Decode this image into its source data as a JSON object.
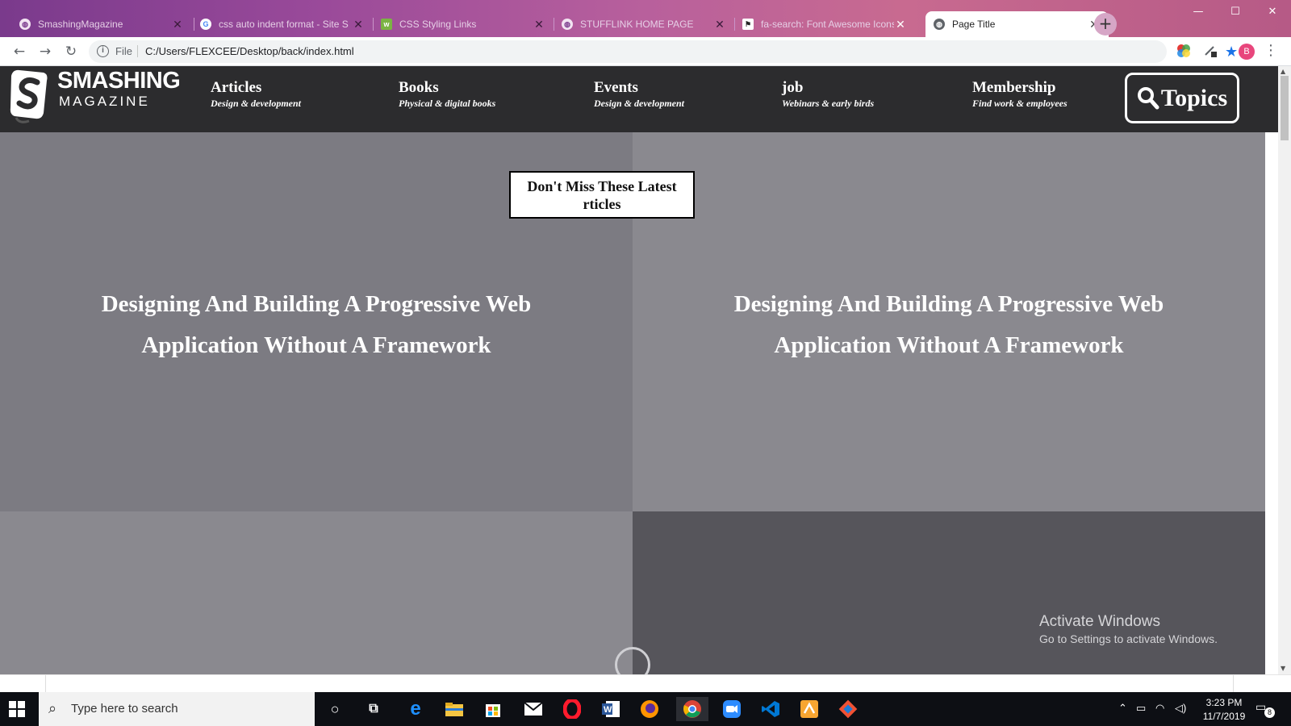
{
  "browser": {
    "tabs": [
      {
        "label": "SmashingMagazine",
        "icon": "globe-icon",
        "active": false
      },
      {
        "label": "css auto indent format - Site S",
        "icon": "google-icon",
        "active": false
      },
      {
        "label": "CSS Styling Links",
        "icon": "w3-icon",
        "active": false
      },
      {
        "label": "STUFFLINK HOME PAGE",
        "icon": "globe-icon",
        "active": false
      },
      {
        "label": "fa-search: Font Awesome Icons",
        "icon": "flag-icon",
        "active": false
      },
      {
        "label": "Page Title",
        "icon": "globe-icon",
        "active": true
      }
    ],
    "address": {
      "scheme_label": "File",
      "url": "C:/Users/FLEXCEE/Desktop/back/index.html"
    },
    "profile_initial": "B",
    "accent_color": "#1a73e8"
  },
  "site": {
    "logo": {
      "line1": "SMASHING",
      "line2": "MAGAZINE"
    },
    "nav": [
      {
        "title": "Articles",
        "subtitle": "Design & development"
      },
      {
        "title": "Books",
        "subtitle": "Physical & digital books"
      },
      {
        "title": "Events",
        "subtitle": "Design & development"
      },
      {
        "title": "job",
        "subtitle": "Webinars & early birds"
      },
      {
        "title": "Membership",
        "subtitle": "Find work & employees"
      }
    ],
    "topics_label": "Topics",
    "latest_banner": "Don't Miss These Latest rticles",
    "panels": [
      {
        "title": "Designing And Building A Progressive Web Application Without A Framework"
      },
      {
        "title": "Designing And Building A Progressive Web Application Without A Framework"
      }
    ],
    "header_color": "#2c2c2e"
  },
  "os": {
    "watermark": {
      "title": "Activate Windows",
      "subtitle": "Go to Settings to activate Windows."
    },
    "search_placeholder": "Type here to search",
    "clock": {
      "time": "3:23 PM",
      "date": "11/7/2019"
    },
    "notifications": "8"
  }
}
